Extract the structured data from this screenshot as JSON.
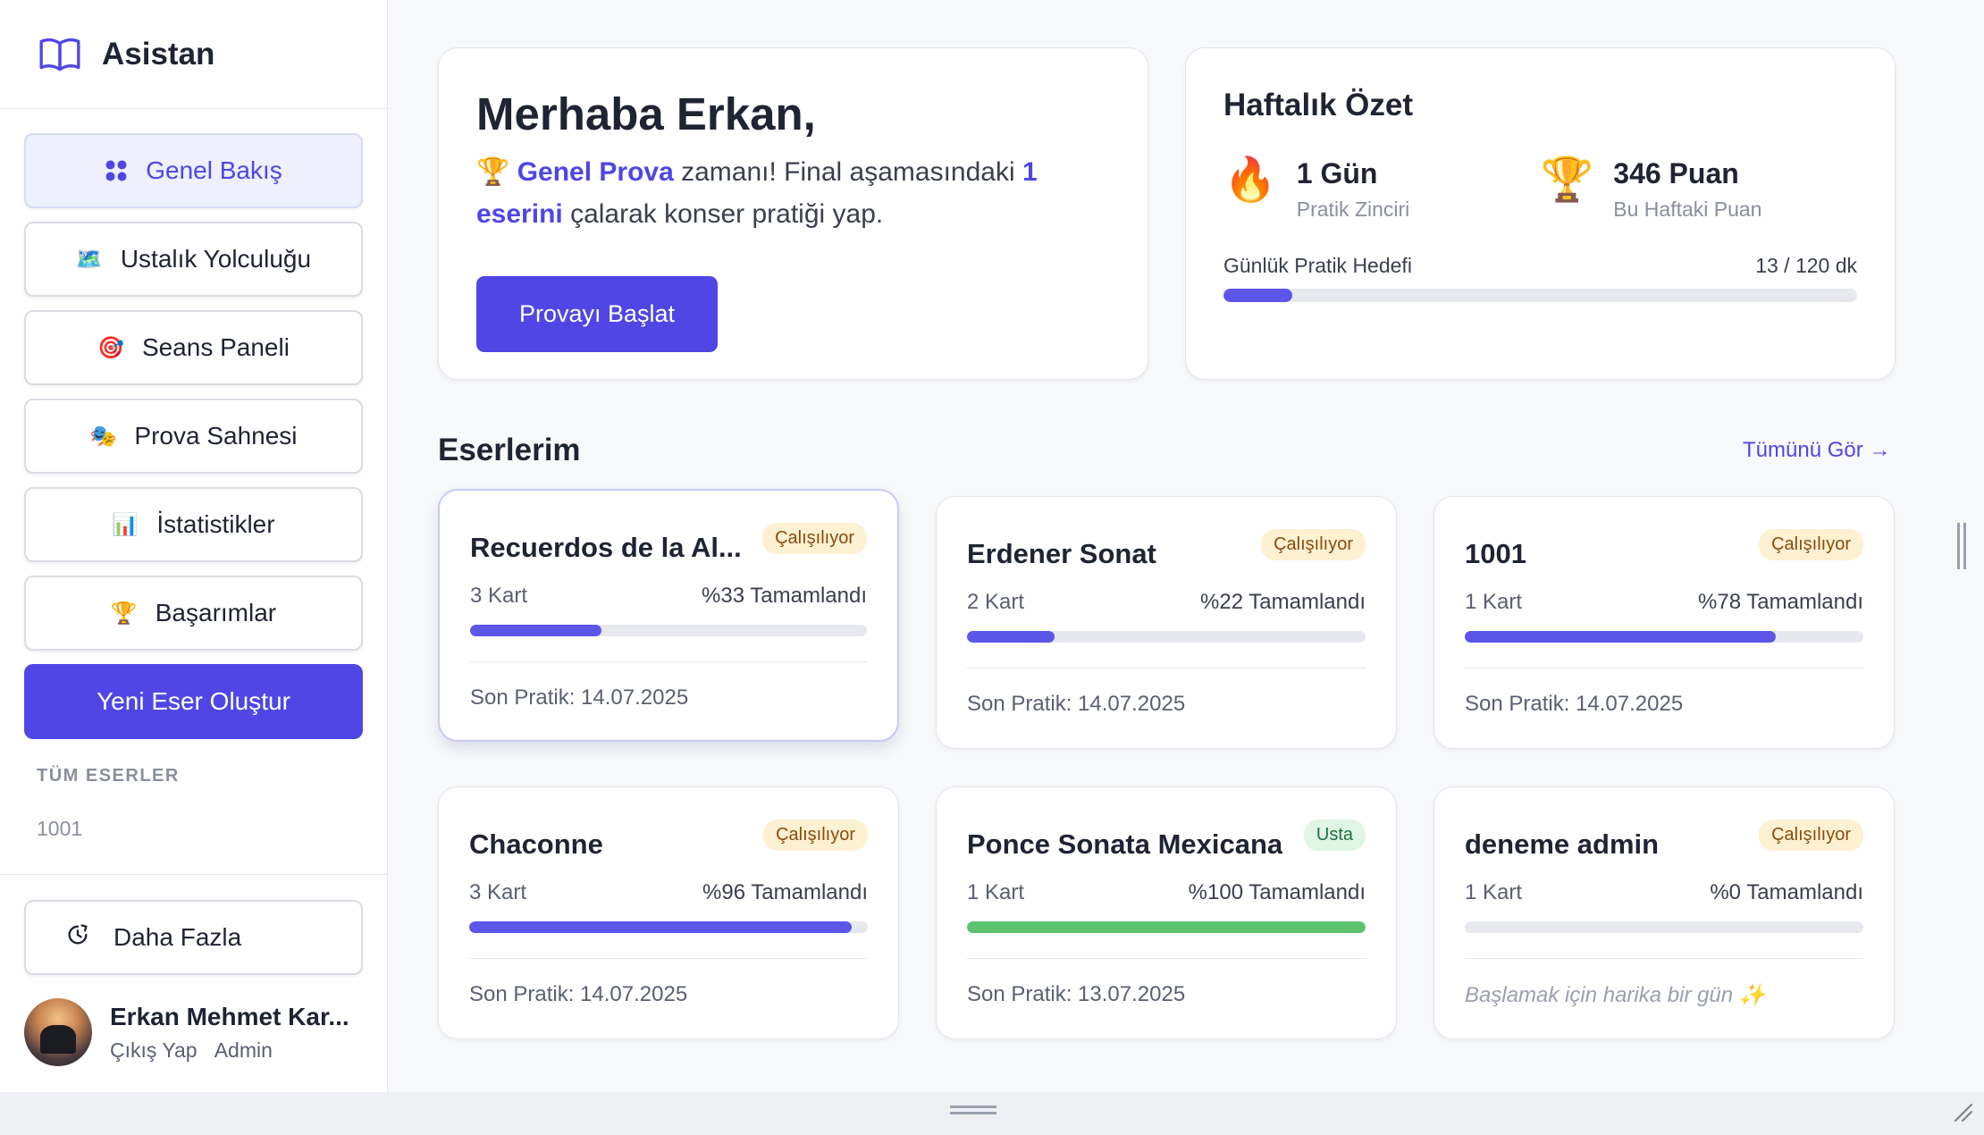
{
  "brand": {
    "title": "Asistan",
    "icon": "book-open-icon"
  },
  "nav": [
    {
      "label": "Genel Bakış",
      "icon": "grid-icon"
    },
    {
      "label": "Ustalık Yolculuğu",
      "icon": "map-icon"
    },
    {
      "label": "Seans Paneli",
      "icon": "target-icon"
    },
    {
      "label": "Prova Sahnesi",
      "icon": "theater-icon"
    },
    {
      "label": "İstatistikler",
      "icon": "bar-chart-icon"
    },
    {
      "label": "Başarımlar",
      "icon": "trophy-icon"
    }
  ],
  "create_button": "Yeni Eser Oluştur",
  "all_works_label": "TÜM ESERLER",
  "all_works": [
    "1001"
  ],
  "more_button": "Daha Fazla",
  "user": {
    "name": "Erkan Mehmet Kar...",
    "logout": "Çıkış Yap",
    "role": "Admin"
  },
  "hello": {
    "title": "Merhaba Erkan,",
    "msg_hl1": "Genel Prova",
    "msg_mid": " zamanı! Final aşamasındaki ",
    "msg_hl2": "1 eserini",
    "msg_end": " çalarak konser pratiği yap.",
    "button": "Provayı Başlat"
  },
  "summary": {
    "title": "Haftalık Özet",
    "streak_value": "1 Gün",
    "streak_label": "Pratik Zinciri",
    "points_value": "346 Puan",
    "points_label": "Bu Haftaki Puan",
    "goal_label": "Günlük Pratik Hedefi",
    "goal_value": "13 / 120 dk",
    "goal_fraction": 0.108
  },
  "works_section": {
    "title": "Eserlerim",
    "see_all": "Tümünü Gör →"
  },
  "works": [
    {
      "title": "Recuerdos de la Al...",
      "badge": "Çalışılıyor",
      "cards": "3 Kart",
      "completion": "%33 Tamamlandı",
      "progress": 0.33,
      "footer": "Son Pratik: 14.07.2025"
    },
    {
      "title": "Erdener Sonat",
      "badge": "Çalışılıyor",
      "cards": "2 Kart",
      "completion": "%22 Tamamlandı",
      "progress": 0.22,
      "footer": "Son Pratik: 14.07.2025"
    },
    {
      "title": "1001",
      "badge": "Çalışılıyor",
      "cards": "1 Kart",
      "completion": "%78 Tamamlandı",
      "progress": 0.78,
      "footer": "Son Pratik: 14.07.2025"
    },
    {
      "title": "Chaconne",
      "badge": "Çalışılıyor",
      "cards": "3 Kart",
      "completion": "%96 Tamamlandı",
      "progress": 0.96,
      "footer": "Son Pratik: 14.07.2025"
    },
    {
      "title": "Ponce Sonata Mexicana",
      "badge": "Usta",
      "cards": "1 Kart",
      "completion": "%100 Tamamlandı",
      "progress": 1.0,
      "footer": "Son Pratik: 13.07.2025"
    },
    {
      "title": "deneme admin",
      "badge": "Çalışılıyor",
      "cards": "1 Kart",
      "completion": "%0 Tamamlandı",
      "progress": 0.0,
      "footer": "Başlamak için harika bir gün ✨"
    }
  ],
  "colors": {
    "accent": "#4f46e5",
    "progress": "#5b55e8",
    "mastered": "#5cc26f",
    "badge_working_bg": "#fdf1d2",
    "badge_master_bg": "#dff6e5"
  }
}
